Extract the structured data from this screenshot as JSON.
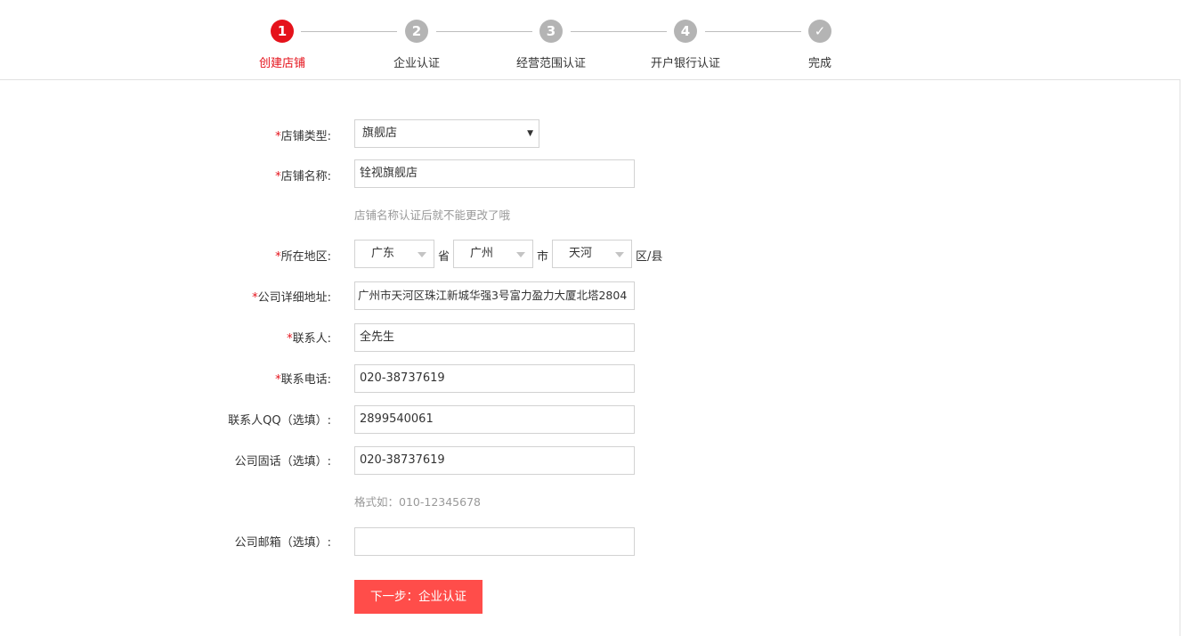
{
  "stepper": {
    "steps": [
      {
        "num": "1",
        "label": "创建店铺"
      },
      {
        "num": "2",
        "label": "企业认证"
      },
      {
        "num": "3",
        "label": "经营范围认证"
      },
      {
        "num": "4",
        "label": "开户银行认证"
      },
      {
        "num": "✓",
        "label": "完成"
      }
    ],
    "active_step": 1,
    "colors": {
      "active": "#e5121b",
      "inactive": "#b4b4b4"
    }
  },
  "form": {
    "required_mark": "*",
    "shop_type": {
      "label": "店铺类型:",
      "value": "旗舰店"
    },
    "shop_name": {
      "label": "店铺名称:",
      "value": "铨视旗舰店",
      "hint": "店铺名称认证后就不能更改了哦"
    },
    "region": {
      "label": "所在地区:",
      "province": "广东",
      "province_unit": "省",
      "city": "广州",
      "city_unit": "市",
      "district": "天河",
      "district_unit": "区/县"
    },
    "address": {
      "label": "公司详细地址:",
      "value": "广州市天河区珠江新城华强3号富力盈力大厦北塔2804"
    },
    "contact": {
      "label": "联系人:",
      "value": "全先生"
    },
    "phone": {
      "label": "联系电话:",
      "value": "020-38737619"
    },
    "qq": {
      "label": "联系人QQ（选填）:",
      "value": "2899540061"
    },
    "landline": {
      "label": "公司固话（选填）:",
      "value": "020-38737619",
      "hint": "格式如：010-12345678"
    },
    "email": {
      "label": "公司邮箱（选填）:",
      "value": ""
    },
    "next_button": "下一步：企业认证"
  },
  "colors": {
    "button": "#ff4d4a",
    "required": "#e5121b",
    "hint": "#999999"
  }
}
